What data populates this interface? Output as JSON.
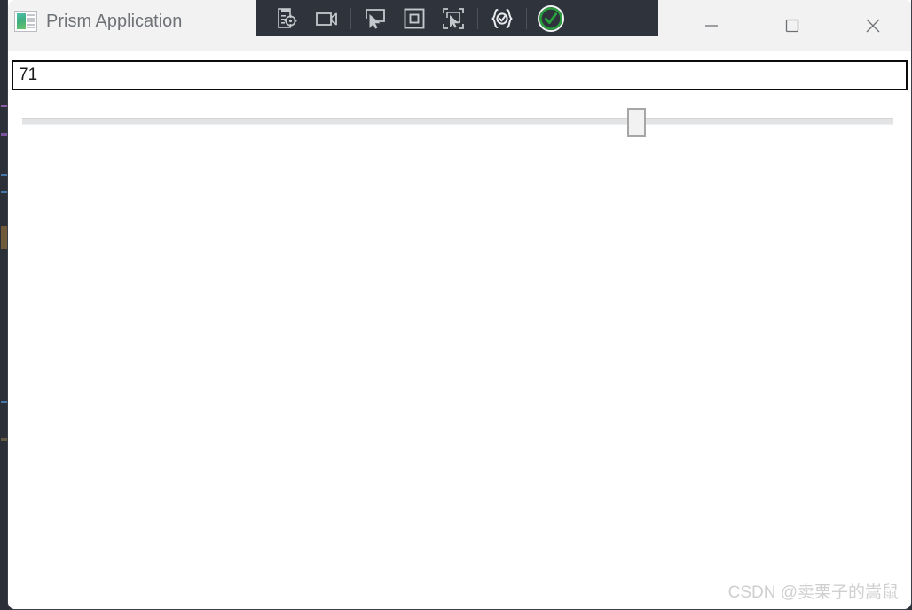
{
  "window": {
    "title": "Prism Application",
    "app_icon": "app-window-thumbnail-icon"
  },
  "title_bar": {
    "controls": [
      {
        "name": "minimize",
        "label": "—",
        "icon": "minimize-icon"
      },
      {
        "name": "maximize",
        "label": "□",
        "icon": "maximize-icon"
      },
      {
        "name": "close",
        "label": "✕",
        "icon": "close-icon"
      }
    ]
  },
  "recorder_toolbar": {
    "background_color": "#2e333c",
    "accent_color": "#29a03c",
    "icon_color": "#c4c8cd",
    "buttons": [
      {
        "name": "inspect-element-button",
        "icon": "document-crosshair-icon"
      },
      {
        "name": "record-button",
        "icon": "video-camera-icon"
      },
      {
        "name": "select-element-button",
        "icon": "cursor-in-panel-icon"
      },
      {
        "name": "highlight-element-button",
        "icon": "nested-square-icon"
      },
      {
        "name": "capture-region-button",
        "icon": "cursor-crop-marks-icon"
      },
      {
        "name": "add-assertion-button",
        "icon": "braces-check-icon"
      },
      {
        "name": "finish-validate-button",
        "icon": "green-check-circle-icon"
      }
    ]
  },
  "main": {
    "textbox": {
      "value": "71",
      "placeholder": ""
    },
    "slider": {
      "value": 71,
      "min": 0,
      "max": 100,
      "thumb_position_percent": 71
    }
  },
  "watermark": {
    "text": "CSDN @卖栗子的嵩鼠"
  }
}
